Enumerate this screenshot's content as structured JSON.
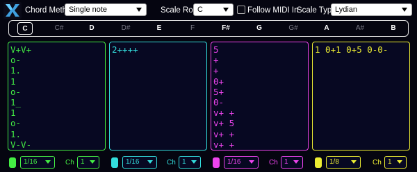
{
  "header": {
    "chord_method_label": "Chord Method",
    "chord_method_value": "Single note",
    "scale_root_label": "Scale Root",
    "scale_root_value": "C",
    "follow_midi_label": "Follow MIDI In",
    "follow_midi_checked": false,
    "scale_type_label": "Scale Type",
    "scale_type_value": "Lydian"
  },
  "keys": [
    {
      "label": "C",
      "natural": true,
      "selected": true
    },
    {
      "label": "C#",
      "natural": false,
      "selected": false
    },
    {
      "label": "D",
      "natural": true,
      "selected": false
    },
    {
      "label": "D#",
      "natural": false,
      "selected": false
    },
    {
      "label": "E",
      "natural": true,
      "selected": false
    },
    {
      "label": "F",
      "natural": false,
      "selected": false
    },
    {
      "label": "F#",
      "natural": true,
      "selected": false
    },
    {
      "label": "G",
      "natural": true,
      "selected": false
    },
    {
      "label": "G#",
      "natural": false,
      "selected": false
    },
    {
      "label": "A",
      "natural": true,
      "selected": false
    },
    {
      "label": "A#",
      "natural": false,
      "selected": false
    },
    {
      "label": "B",
      "natural": true,
      "selected": false
    }
  ],
  "tracks": [
    {
      "color": "#44ee44",
      "pattern": [
        "V+V+",
        "o-",
        "1.",
        "1",
        "o-",
        "1_",
        "1",
        "o-",
        "1.",
        "V-V-"
      ],
      "rate": "1/16",
      "ch_label": "Ch",
      "channel": "1"
    },
    {
      "color": "#33dddd",
      "pattern": [
        "2++++"
      ],
      "rate": "1/16",
      "ch_label": "Ch",
      "channel": "1"
    },
    {
      "color": "#ee44ee",
      "pattern": [
        "5",
        "+",
        "+",
        "0+",
        "5+",
        "0-",
        "v+ +",
        "v+ 5",
        "v+ +",
        "v+ +"
      ],
      "rate": "1/16",
      "ch_label": "Ch",
      "channel": "1"
    },
    {
      "color": "#eeee33",
      "pattern": [
        "1 0+1 0+5 0-0-"
      ],
      "rate": "1/8",
      "ch_label": "Ch",
      "channel": "1"
    }
  ]
}
